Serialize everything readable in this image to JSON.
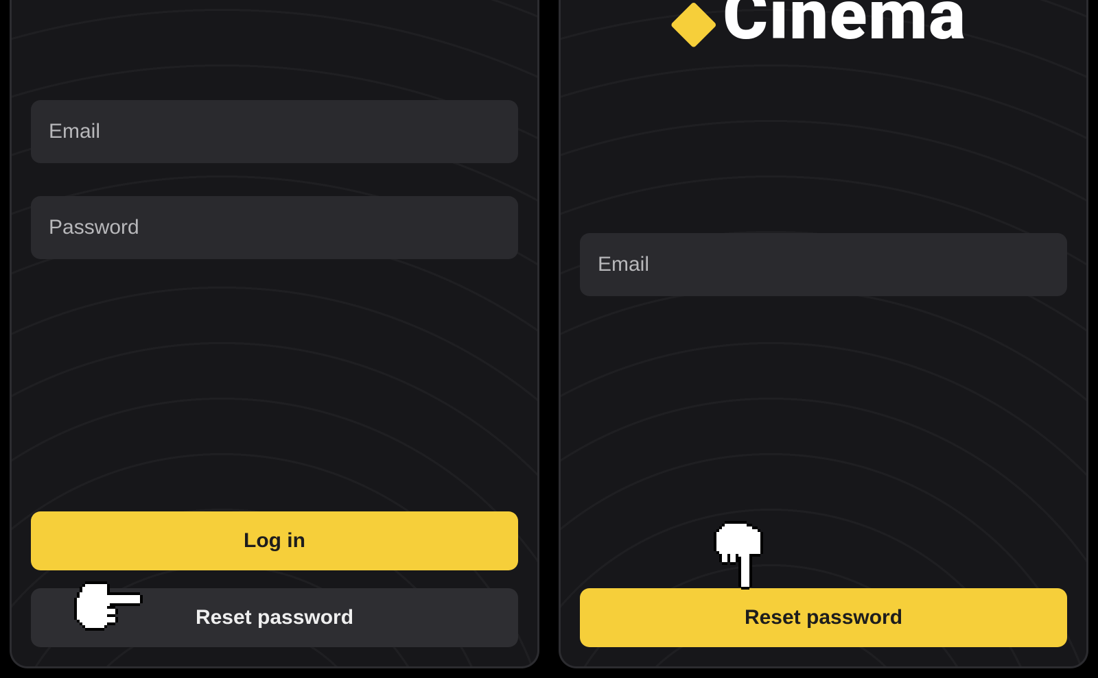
{
  "colors": {
    "accent": "#f6cf3a",
    "panel": "#17171a",
    "input": "#2a2a2e",
    "dark_button": "#2e2e32"
  },
  "logo": {
    "text": "Cinema"
  },
  "login": {
    "email_placeholder": "Email",
    "password_placeholder": "Password",
    "login_label": "Log in",
    "reset_label": "Reset password"
  },
  "reset": {
    "email_placeholder": "Email",
    "submit_label": "Reset password"
  }
}
